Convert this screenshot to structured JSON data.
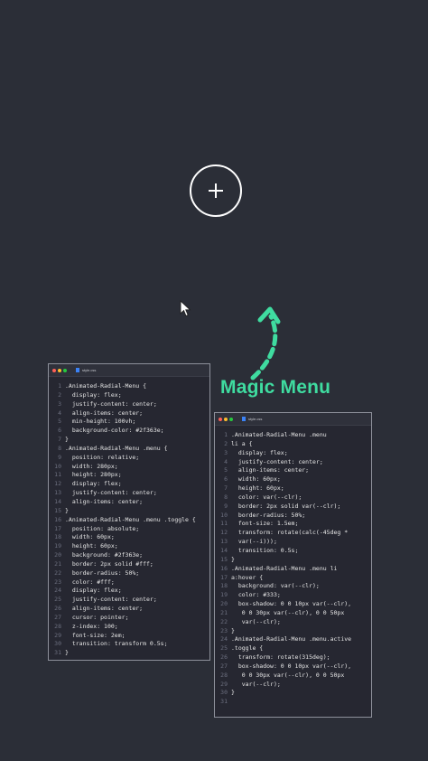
{
  "colors": {
    "background": "#2b2e37",
    "accent": "#3fdca0",
    "editor_bg": "#262731",
    "dot_red": "#ff5f56",
    "dot_yellow": "#ffbd2e",
    "dot_green": "#27c93f"
  },
  "toggle": {
    "icon": "plus-icon"
  },
  "heading": {
    "text": "Magic Menu"
  },
  "editor_left": {
    "tab": "style.css",
    "lines": [
      ".Animated-Radial-Menu {",
      "  display: flex;",
      "  justify-content: center;",
      "  align-items: center;",
      "  min-height: 100vh;",
      "  background-color: #2f363e;",
      "}",
      ".Animated-Radial-Menu .menu {",
      "  position: relative;",
      "  width: 280px;",
      "  height: 280px;",
      "  display: flex;",
      "  justify-content: center;",
      "  align-items: center;",
      "}",
      ".Animated-Radial-Menu .menu .toggle {",
      "  position: absolute;",
      "  width: 60px;",
      "  height: 60px;",
      "  background: #2f363e;",
      "  border: 2px solid #fff;",
      "  border-radius: 50%;",
      "  color: #fff;",
      "  display: flex;",
      "  justify-content: center;",
      "  align-items: center;",
      "  cursor: pointer;",
      "  z-index: 100;",
      "  font-size: 2em;",
      "  transition: transform 0.5s;",
      "}"
    ]
  },
  "editor_right": {
    "tab": "style.css",
    "lines": [
      ".Animated-Radial-Menu .menu",
      "li a {",
      "  display: flex;",
      "  justify-content: center;",
      "  align-items: center;",
      "  width: 60px;",
      "  height: 60px;",
      "  color: var(--clr);",
      "  border: 2px solid var(--clr);",
      "  border-radius: 50%;",
      "  font-size: 1.5em;",
      "  transform: rotate(calc(-45deg *",
      "  var(--i)));",
      "  transition: 0.5s;",
      "}",
      ".Animated-Radial-Menu .menu li",
      "a:hover {",
      "  background: var(--clr);",
      "  color: #333;",
      "  box-shadow: 0 0 10px var(--clr),",
      "   0 0 30px var(--clr), 0 0 50px",
      "   var(--clr);",
      "}",
      ".Animated-Radial-Menu .menu.active",
      ".toggle {",
      "  transform: rotate(315deg);",
      "  box-shadow: 0 0 10px var(--clr),",
      "   0 0 30px var(--clr), 0 0 50px",
      "   var(--clr);",
      "}",
      ""
    ]
  }
}
